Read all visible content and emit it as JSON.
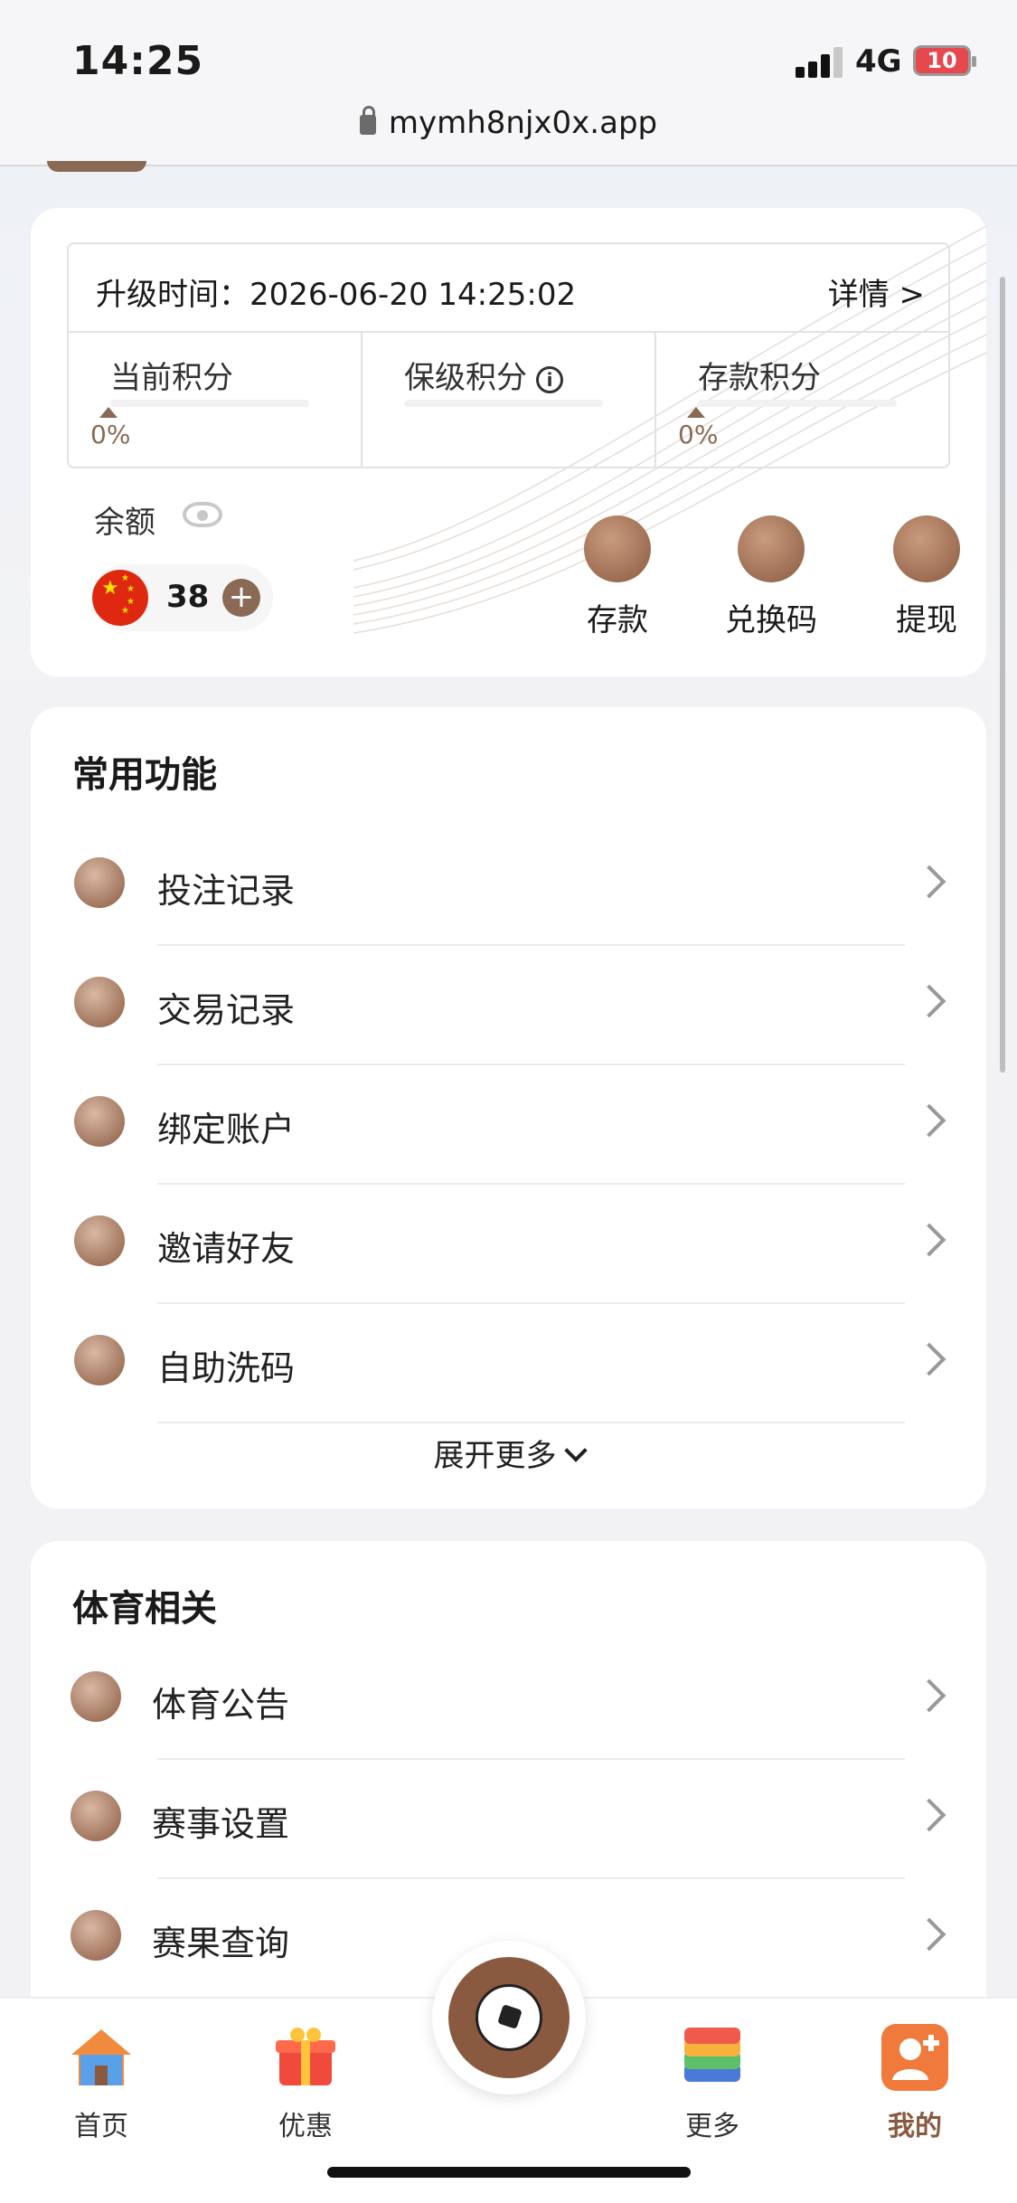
{
  "status_bar": {
    "time": "14:25",
    "network": "4G",
    "battery": "10"
  },
  "browser": {
    "url": "mymh8njx0x.app"
  },
  "vip_card": {
    "upgrade_time": "升级时间：2026-06-20 14:25:02",
    "details_link": "详情 >",
    "metrics": [
      {
        "label": "当前积分",
        "percent": "0%"
      },
      {
        "label": "保级积分",
        "percent": ""
      },
      {
        "label": "存款积分",
        "percent": "0%"
      }
    ]
  },
  "wallet": {
    "balance_label": "余额",
    "balance_amount": "38",
    "actions": [
      {
        "label": "存款",
        "icon": "wallet-icon"
      },
      {
        "label": "兑换码",
        "icon": "coupon-icon"
      },
      {
        "label": "提现",
        "icon": "dollar-coin-icon"
      }
    ]
  },
  "common_functions": {
    "title": "常用功能",
    "items": [
      {
        "label": "投注记录",
        "icon": "clipboard-check-icon"
      },
      {
        "label": "交易记录",
        "icon": "notepad-icon"
      },
      {
        "label": "绑定账户",
        "icon": "cards-icon"
      },
      {
        "label": "邀请好友",
        "icon": "person-icon"
      },
      {
        "label": "自助洗码",
        "icon": "chip-icon"
      }
    ],
    "expand_label": "展开更多"
  },
  "sports": {
    "title": "体育相关",
    "items": [
      {
        "label": "体育公告",
        "icon": "notice-icon"
      },
      {
        "label": "赛事设置",
        "icon": "gear-icon"
      },
      {
        "label": "赛果查询",
        "icon": "trophy-icon"
      }
    ]
  },
  "tab_bar": {
    "tabs": [
      {
        "label": "首页",
        "icon": "house-icon"
      },
      {
        "label": "优惠",
        "icon": "gift-icon"
      },
      {
        "label": "更多",
        "icon": "layers-icon"
      },
      {
        "label": "我的",
        "icon": "add-user-icon"
      }
    ],
    "center_icon": "soccer-ball-icon"
  },
  "colors": {
    "accent": "#8a5a40",
    "background": "#f2f2f4",
    "card": "#ffffff"
  }
}
